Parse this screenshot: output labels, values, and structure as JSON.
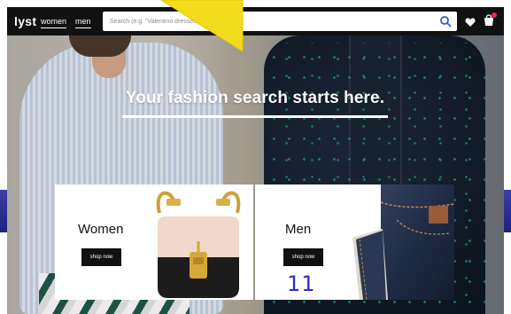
{
  "header": {
    "logo": "lyst",
    "nav": [
      {
        "label": "women"
      },
      {
        "label": "men"
      }
    ],
    "search": {
      "placeholder": "Search (e.g. \"Valentino dresses\")",
      "value": ""
    }
  },
  "hero": {
    "headline": "Your fashion search starts here."
  },
  "categories": [
    {
      "title": "Women",
      "button": "shop now"
    },
    {
      "title": "Men",
      "button": "shop now"
    }
  ],
  "slide_number": "11",
  "colors": {
    "topbar": "#111111",
    "search_icon": "#2f5bd3",
    "bag_badge": "#e8294a",
    "pointer": "#f3dc1e",
    "slide_number": "#2a2fd0",
    "edge_bar": "#2a2d8e"
  },
  "icons": {
    "search": "search-icon",
    "wishlist": "heart-icon",
    "bag": "shopping-bag-icon"
  }
}
